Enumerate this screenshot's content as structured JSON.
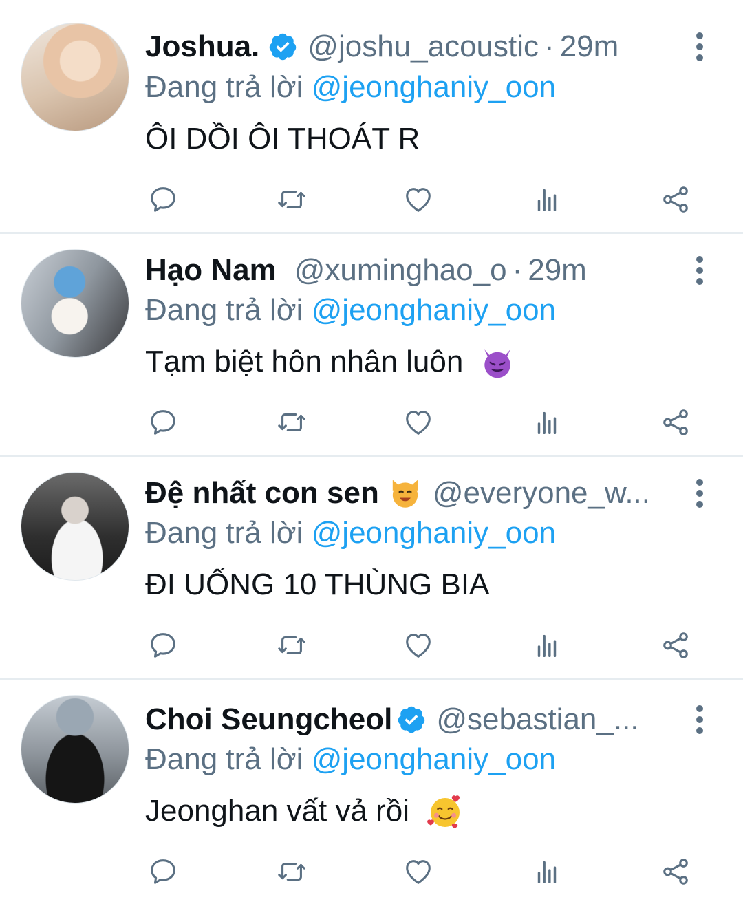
{
  "tweets": [
    {
      "display_name": "Joshua.",
      "verified": true,
      "handle": "@joshu_acoustic",
      "separator": "·",
      "time": "29m",
      "reply_prefix": "Đang trả lời",
      "reply_to": "@jeonghaniy_oon",
      "text": "ÔI DỒI ÔI THOÁT R",
      "emoji": ""
    },
    {
      "display_name": "Hạo Nam",
      "verified": false,
      "handle": "@xuminghao_o",
      "separator": "·",
      "time": "29m",
      "reply_prefix": "Đang trả lời",
      "reply_to": "@jeonghaniy_oon",
      "text": "Tạm biệt hôn nhân luôn",
      "emoji": "smiling-devil"
    },
    {
      "display_name": "Đệ nhất con sen",
      "name_emoji": "smiling-cat",
      "verified": false,
      "handle": "@everyone_w...",
      "separator": "",
      "time": "",
      "reply_prefix": "Đang trả lời",
      "reply_to": "@jeonghaniy_oon",
      "text": "ĐI UỐNG 10 THÙNG BIA",
      "emoji": ""
    },
    {
      "display_name": "Choi Seungcheol",
      "verified": true,
      "handle": "@sebastian_...",
      "separator": "",
      "time": "",
      "reply_prefix": "Đang trả lời",
      "reply_to": "@jeonghaniy_oon",
      "text": "Jeonghan vất vả rồi",
      "emoji": "smiling-face-with-hearts"
    }
  ],
  "icons": {
    "reply": "reply-icon",
    "retweet": "retweet-icon",
    "like": "heart-icon",
    "analytics": "analytics-icon",
    "share": "share-icon",
    "more": "more-vertical-icon",
    "verified": "verified-badge-icon"
  },
  "colors": {
    "link": "#1da1f2",
    "muted": "#5b7083",
    "text": "#0f1419",
    "divider": "#e6ecf0"
  }
}
